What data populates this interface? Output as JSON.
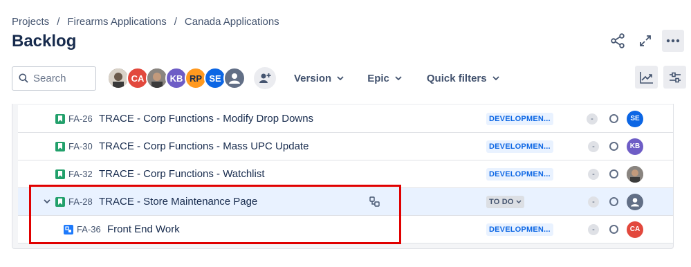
{
  "breadcrumb": [
    "Projects",
    "Firearms Applications",
    "Canada Applications"
  ],
  "page_title": "Backlog",
  "search": {
    "placeholder": "Search"
  },
  "avatars": [
    {
      "initials": "",
      "color": "#7a6a5c",
      "kind": "photo"
    },
    {
      "initials": "CA",
      "color": "#e2483d",
      "kind": "initials"
    },
    {
      "initials": "",
      "color": "#5e5a57",
      "kind": "photo"
    },
    {
      "initials": "KB",
      "color": "#6e5dc6",
      "kind": "initials"
    },
    {
      "initials": "RP",
      "color": "#ff991f",
      "kind": "initials"
    },
    {
      "initials": "SE",
      "color": "#0c66e4",
      "kind": "initials"
    },
    {
      "initials": "",
      "color": "#626f86",
      "kind": "default"
    }
  ],
  "filters": {
    "version": "Version",
    "epic": "Epic",
    "quick_filters": "Quick filters"
  },
  "issues": [
    {
      "key": "FA-26",
      "summary": "TRACE - Corp Functions - Modify Drop Downs",
      "status": "DEVELOPMEN...",
      "estimate": "-",
      "assignee": "SE",
      "assignee_color": "#0c66e4",
      "type": "story"
    },
    {
      "key": "FA-30",
      "summary": "TRACE - Corp Functions - Mass UPC Update",
      "status": "DEVELOPMEN...",
      "estimate": "-",
      "assignee": "KB",
      "assignee_color": "#6e5dc6",
      "type": "story"
    },
    {
      "key": "FA-32",
      "summary": "TRACE - Corp Functions - Watchlist",
      "status": "DEVELOPMEN...",
      "estimate": "-",
      "assignee": "",
      "assignee_color": "#5e5a57",
      "type": "story"
    },
    {
      "key": "FA-28",
      "summary": "TRACE - Store Maintenance Page",
      "status": "TO DO",
      "estimate": "-",
      "assignee": "",
      "assignee_color": "#626f86",
      "type": "story"
    },
    {
      "key": "FA-36",
      "summary": "Front End Work",
      "status": "DEVELOPMEN...",
      "estimate": "-",
      "assignee": "CA",
      "assignee_color": "#e2483d",
      "type": "subtask"
    }
  ],
  "colors": {
    "story_icon": "#22a06b",
    "subtask_icon": "#1d7afc",
    "highlight": "#e00000"
  }
}
